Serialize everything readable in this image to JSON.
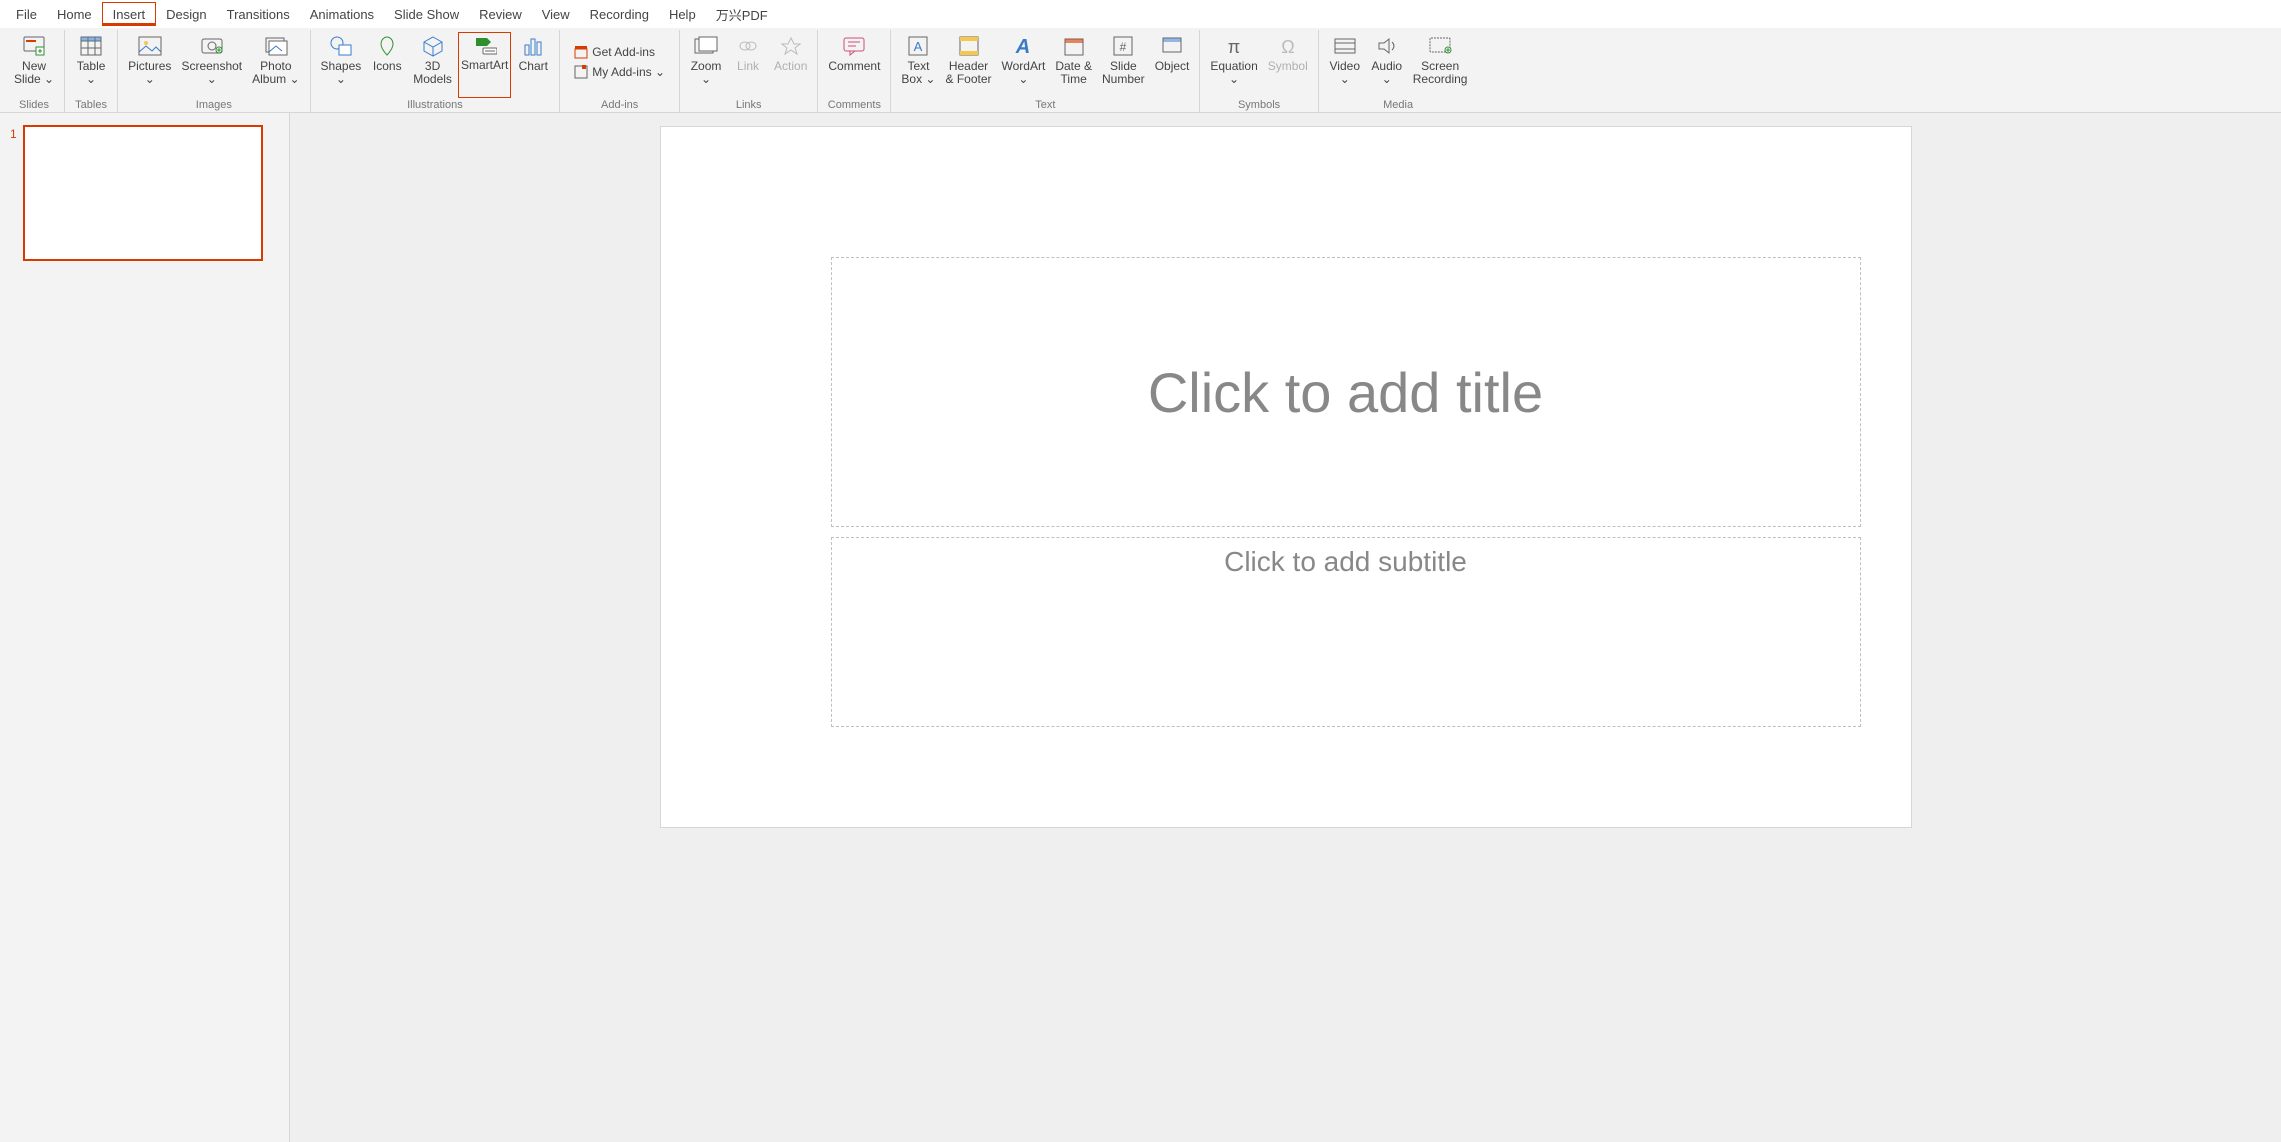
{
  "menu": {
    "items": [
      "File",
      "Home",
      "Insert",
      "Design",
      "Transitions",
      "Animations",
      "Slide Show",
      "Review",
      "View",
      "Recording",
      "Help",
      "万兴PDF"
    ],
    "active": "Insert"
  },
  "ribbon": {
    "groups": {
      "slides": {
        "label": "Slides",
        "newSlide": "New\nSlide ⌄"
      },
      "tables": {
        "label": "Tables",
        "table": "Table\n⌄"
      },
      "images": {
        "label": "Images",
        "pictures": "Pictures\n⌄",
        "screenshot": "Screenshot\n⌄",
        "photoAlbum": "Photo\nAlbum ⌄"
      },
      "illustrations": {
        "label": "Illustrations",
        "shapes": "Shapes\n⌄",
        "icons": "Icons",
        "models": "3D\nModels",
        "smartart": "SmartArt",
        "chart": "Chart"
      },
      "addins": {
        "label": "Add-ins",
        "get": "Get Add-ins",
        "my": "My Add-ins  ⌄"
      },
      "links": {
        "label": "Links",
        "zoom": "Zoom\n⌄",
        "link": "Link",
        "action": "Action"
      },
      "comments": {
        "label": "Comments",
        "comment": "Comment"
      },
      "text": {
        "label": "Text",
        "textbox": "Text\nBox ⌄",
        "headerFooter": "Header\n& Footer",
        "wordart": "WordArt\n⌄",
        "dateTime": "Date &\nTime",
        "slideNumber": "Slide\nNumber",
        "object": "Object"
      },
      "symbols": {
        "label": "Symbols",
        "equation": "Equation\n⌄",
        "symbol": "Symbol"
      },
      "media": {
        "label": "Media",
        "video": "Video\n⌄",
        "audio": "Audio\n⌄",
        "screenrec": "Screen\nRecording"
      }
    }
  },
  "thumb": {
    "number": "1"
  },
  "slide": {
    "titlePlaceholder": "Click to add title",
    "subtitlePlaceholder": "Click to add subtitle"
  }
}
